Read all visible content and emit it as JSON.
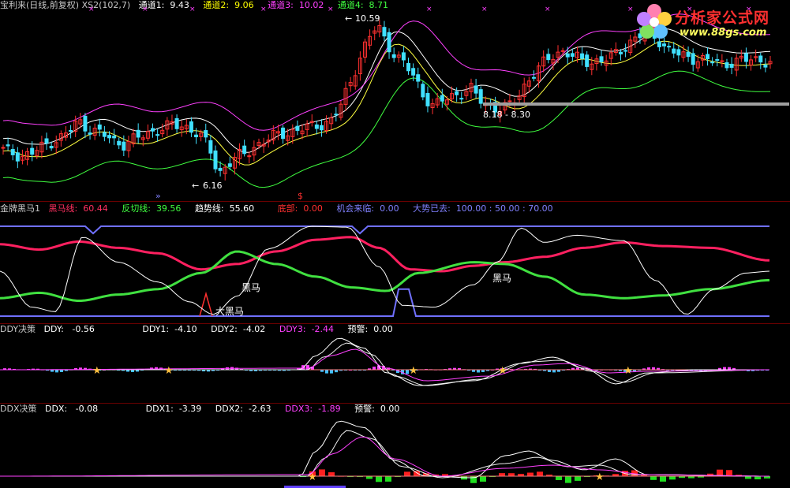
{
  "main": {
    "title": "宝利来(日线,前复权) XS2(102,7)",
    "channels": [
      {
        "label": "通道1:",
        "value": "9.43",
        "color": "#ffffff"
      },
      {
        "label": "通道2:",
        "value": "9.06",
        "color": "#ffff00"
      },
      {
        "label": "通道3:",
        "value": "10.02",
        "color": "#ff40ff"
      },
      {
        "label": "通道4:",
        "value": "8.71",
        "color": "#40ff40"
      }
    ],
    "annot_high": "10.59",
    "annot_low": "6.16",
    "annot_range": "8.18 - 8.30"
  },
  "logo": {
    "name": "分析家公式网",
    "url": "www.88gs.com"
  },
  "ind1": {
    "title": "金牌黑马1",
    "items": [
      {
        "label": "黑马线:",
        "value": "60.44",
        "color": "#ff3060"
      },
      {
        "label": "反切线:",
        "value": "39.56",
        "color": "#40ff40"
      },
      {
        "label": "趋势线:",
        "value": "55.60",
        "color": "#ffffff"
      },
      {
        "label": "底部:",
        "value": "0.00",
        "color": "#ff3030"
      },
      {
        "label": "机会来临:",
        "value": "0.00",
        "color": "#8080ff"
      },
      {
        "label": "大势已去:",
        "value": "100.00 : 50.00 : 70.00",
        "color": "#8080ff"
      }
    ],
    "label_heima": "黑马",
    "label_heima2": "黑马",
    "label_big": "大黑马"
  },
  "ind2": {
    "title": "DDY决策",
    "items": [
      {
        "label": "DDY:",
        "value": "-0.56",
        "color": "#ffffff"
      },
      {
        "label": "DDY1:",
        "value": "-4.10",
        "color": "#ffffff"
      },
      {
        "label": "DDY2:",
        "value": "-4.02",
        "color": "#ffffff"
      },
      {
        "label": "DDY3:",
        "value": "-2.44",
        "color": "#ff40ff"
      },
      {
        "label": "预警:",
        "value": "0.00",
        "color": "#ffffff"
      }
    ]
  },
  "ind3": {
    "title": "DDX决策",
    "items": [
      {
        "label": "DDX:",
        "value": "-0.08",
        "color": "#ffffff"
      },
      {
        "label": "DDX1:",
        "value": "-3.39",
        "color": "#ffffff"
      },
      {
        "label": "DDX2:",
        "value": "-2.63",
        "color": "#ffffff"
      },
      {
        "label": "DDX3:",
        "value": "-1.89",
        "color": "#ff40ff"
      },
      {
        "label": "预警:",
        "value": "0.00",
        "color": "#ffffff"
      }
    ]
  },
  "chart_data": {
    "type": "line",
    "price_path": [
      7.1,
      7.0,
      6.9,
      7.0,
      7.15,
      7.3,
      7.4,
      7.6,
      7.9,
      7.7,
      7.6,
      7.5,
      7.3,
      7.25,
      7.4,
      7.5,
      7.6,
      7.7,
      7.8,
      7.75,
      7.7,
      7.5,
      7.2,
      6.4,
      6.7,
      6.9,
      7.0,
      7.2,
      7.35,
      7.5,
      7.55,
      7.6,
      7.7,
      7.75,
      7.8,
      7.9,
      8.3,
      8.9,
      9.6,
      10.2,
      10.59,
      10.1,
      9.7,
      9.5,
      9.1,
      8.6,
      8.3,
      8.5,
      8.6,
      8.7,
      8.8,
      8.5,
      8.3,
      8.25,
      8.3,
      8.6,
      9.0,
      9.3,
      9.6,
      9.8,
      9.85,
      9.7,
      9.6,
      9.55,
      9.6,
      9.7,
      9.9,
      10.1,
      10.3,
      10.4,
      10.2,
      9.9,
      9.8,
      9.7,
      9.65,
      9.6,
      9.6,
      9.5,
      9.55,
      9.6,
      9.65,
      9.6,
      9.55
    ]
  }
}
